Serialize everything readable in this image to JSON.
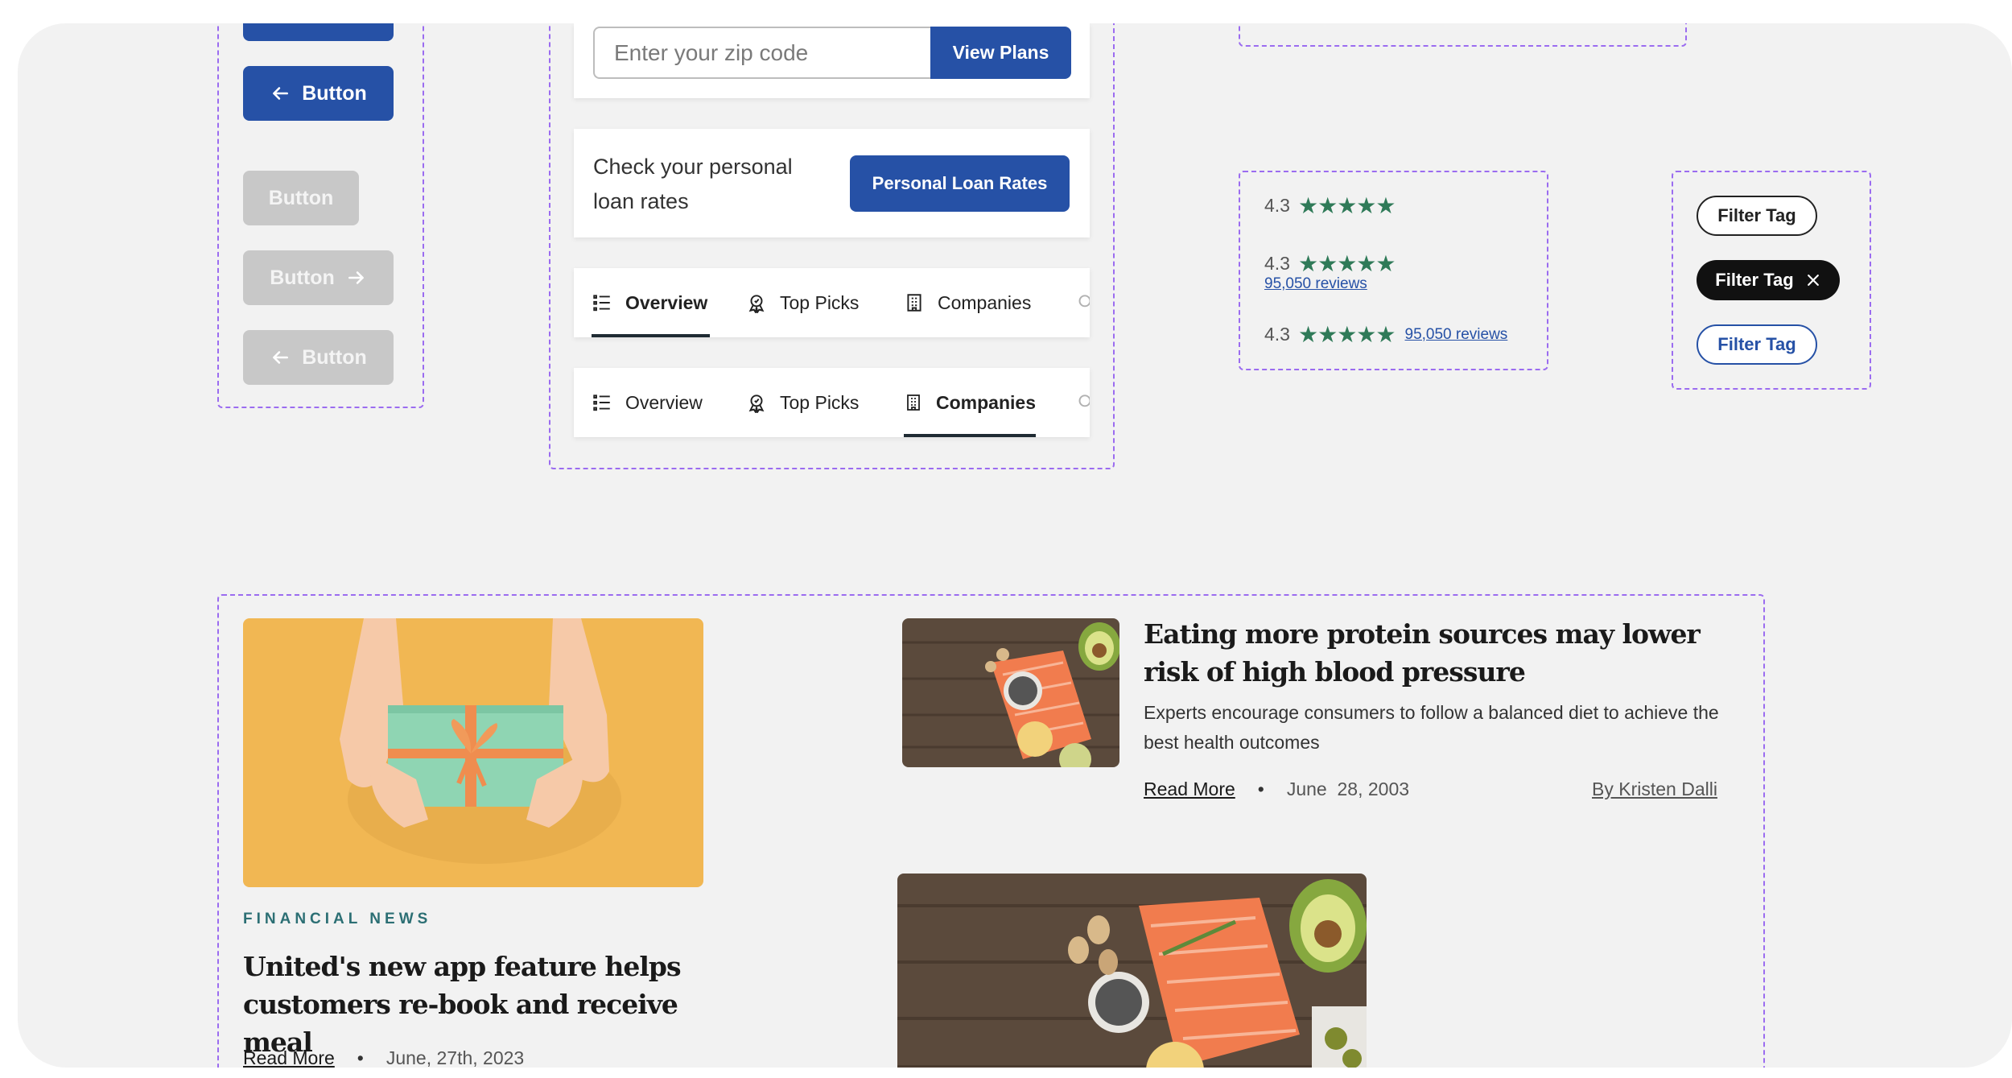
{
  "buttons": {
    "label_arrow_left": "Button",
    "label_disabled": "Button",
    "label_disabled_arrow_right": "Button",
    "label_disabled_arrow_left": "Button"
  },
  "zip_widget": {
    "placeholder": "Enter your zip code",
    "button_label": "View Plans"
  },
  "loan_widget": {
    "text": "Check your personal loan rates",
    "button_label": "Personal Loan Rates"
  },
  "tabs_a": {
    "items": [
      {
        "label": "Overview",
        "icon": "list-icon",
        "active": true
      },
      {
        "label": "Top Picks",
        "icon": "badge-icon",
        "active": false
      },
      {
        "label": "Companies",
        "icon": "building-icon",
        "active": false
      }
    ]
  },
  "tabs_b": {
    "items": [
      {
        "label": "Overview",
        "icon": "list-icon",
        "active": false
      },
      {
        "label": "Top Picks",
        "icon": "badge-icon",
        "active": false
      },
      {
        "label": "Companies",
        "icon": "building-icon",
        "active": true
      }
    ]
  },
  "ratings": {
    "score": "4.3",
    "stars": "★★★★★",
    "reviews": "95,050 reviews",
    "star_color": "#2f7a58"
  },
  "filter_tags": {
    "outline": "Filter Tag",
    "selected": "Filter Tag",
    "blue": "Filter Tag"
  },
  "article_featured": {
    "category": "FINANCIAL NEWS",
    "title": "United's new app feature helps customers re-book and receive meal",
    "read_more": "Read More",
    "date": "June, 27th, 2023"
  },
  "article_side": {
    "title": "Eating more protein sources may lower risk of high blood pressure",
    "description": "Experts encourage consumers to follow a balanced diet to achieve the best health outcomes",
    "read_more": "Read More",
    "date": "June  28, 2003",
    "author": "By Kristen Dalli"
  },
  "colors": {
    "primary": "#2651a6",
    "dash": "#9b6cf0",
    "eyebrow": "#2c6f74"
  }
}
